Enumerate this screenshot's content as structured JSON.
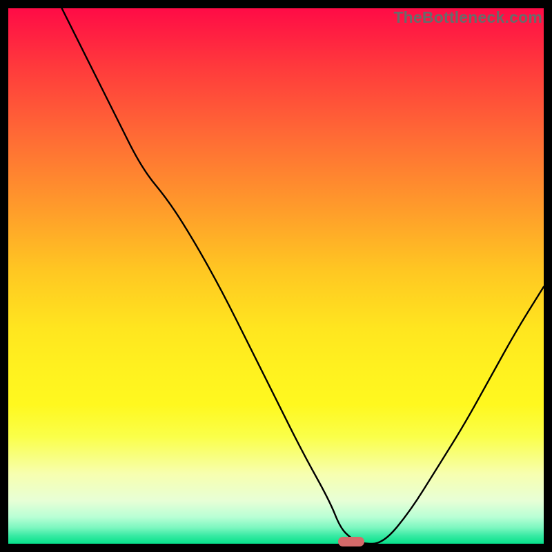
{
  "watermark": "TheBottleneck.com",
  "colors": {
    "background": "#000000",
    "gradient_top": "#ff0b46",
    "gradient_bottom": "#07e18b",
    "curve": "#000000",
    "marker": "#d46a6a"
  },
  "chart_data": {
    "type": "line",
    "title": "",
    "xlabel": "",
    "ylabel": "",
    "xlim": [
      0,
      100
    ],
    "ylim": [
      0,
      100
    ],
    "grid": false,
    "series": [
      {
        "name": "bottleneck-curve",
        "x": [
          10,
          15,
          20,
          25,
          30,
          35,
          40,
          45,
          50,
          55,
          60,
          62,
          64,
          66,
          70,
          75,
          80,
          85,
          90,
          95,
          100
        ],
        "values": [
          100,
          90,
          80,
          70,
          64,
          56,
          47,
          37,
          27,
          17,
          8,
          3,
          1,
          0,
          0,
          6,
          14,
          22,
          31,
          40,
          48
        ]
      }
    ],
    "annotations": [
      {
        "name": "optimal-marker",
        "x": 64,
        "y": 0,
        "shape": "pill"
      }
    ]
  }
}
